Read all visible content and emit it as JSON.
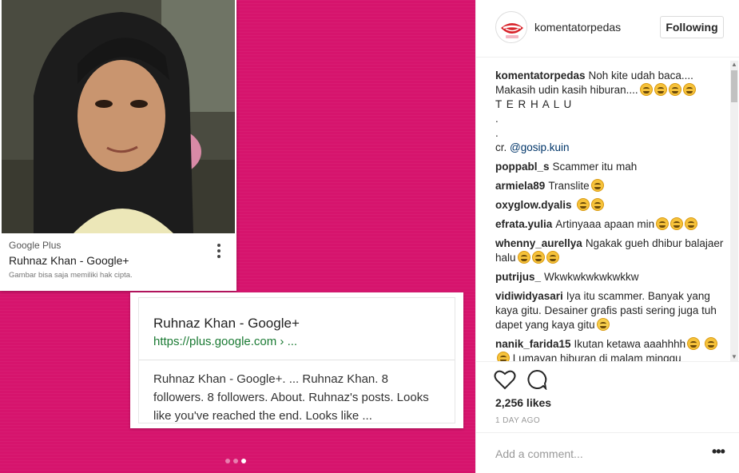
{
  "media": {
    "card": {
      "source": "Google Plus",
      "title": "Ruhnaz Khan - Google+",
      "copyright": "Gambar bisa saja memiliki hak cipta."
    },
    "result": {
      "title": "Ruhnaz Khan - Google+",
      "url": "https://plus.google.com › ...",
      "snippet": "Ruhnaz Khan - Google+. ... Ruhnaz Khan. 8 followers. 8 followers. About. Ruhnaz's posts. Looks like you've reached the end. Looks like  ..."
    },
    "carousel": {
      "count": 3,
      "active_index": 2
    },
    "background_color": "#d6146d"
  },
  "post": {
    "username": "komentatorpedas",
    "follow_label": "Following",
    "caption": {
      "user": "komentatorpedas",
      "text": "Noh kite udah baca.... Makasih udin kasih hiburan....",
      "line2": "T E R H A L U",
      "dot1": ".",
      "dot2": ".",
      "credit_prefix": "cr. ",
      "credit_handle": "@gosip.kuin"
    },
    "comments": [
      {
        "user": "poppabl_s",
        "text": "Scammer itu mah"
      },
      {
        "user": "armiela89",
        "text": "Translite"
      },
      {
        "user": "oxyglow.dyalis",
        "text": ""
      },
      {
        "user": "efrata.yulia",
        "text": "Artinyaaa apaan min"
      },
      {
        "user": "whenny_aurellya",
        "text": "Ngakak gueh dhibur balajaer halu"
      },
      {
        "user": "putrijus_",
        "text": "Wkwkwkwkwkwkkw"
      },
      {
        "user": "vidiwidyasari",
        "text": "Iya itu scammer. Banyak yang kaya gitu. Desainer grafis pasti sering juga tuh dapet yang kaya gitu"
      },
      {
        "user": "nanik_farida15",
        "text": "Ikutan ketawa aaahhhh"
      }
    ],
    "comment_tail": "Lumayan hiburan di malam minggu",
    "likes": "2,256 likes",
    "time_ago": "1 DAY AGO",
    "add_comment_placeholder": "Add a comment...",
    "options_glyph": "•••"
  }
}
